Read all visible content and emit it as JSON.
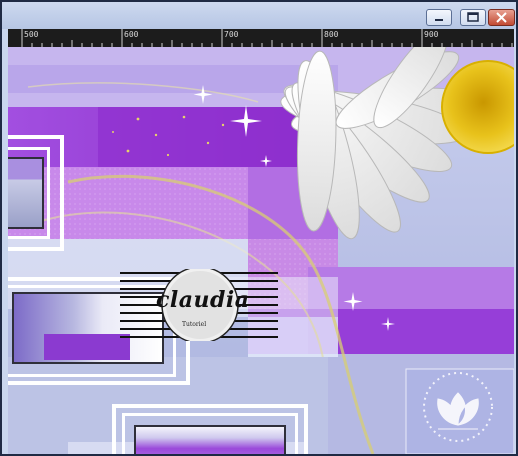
{
  "window": {
    "buttons": [
      {
        "name": "minimize-button",
        "icon": "minimize-icon"
      },
      {
        "name": "maximize-button",
        "icon": "maximize-icon"
      },
      {
        "name": "close-button",
        "icon": "close-icon"
      }
    ]
  },
  "ruler": {
    "labels": [
      "500",
      "600",
      "700",
      "800",
      "900"
    ]
  },
  "watermark": {
    "name": "claudia",
    "subtitle": "Tutoriel"
  },
  "colors": {
    "purple_main": "#9b3fd6",
    "purple_light": "#c58be6",
    "lavender": "#b9bfe6",
    "daisy_center": "#e8c21b",
    "frame_dark": "#1f2a44"
  }
}
